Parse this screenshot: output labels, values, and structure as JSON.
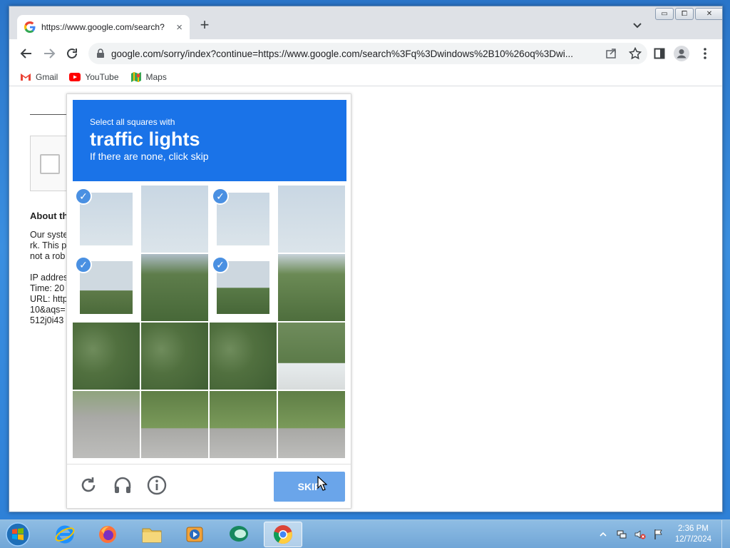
{
  "browser": {
    "tab_title": "https://www.google.com/search?",
    "tab_close": "×",
    "new_tab": "+",
    "url": "google.com/sorry/index?continue=https://www.google.com/search%3Fq%3Dwindows%2B10%26oq%3Dwi...",
    "window_controls": [
      "▭",
      "⧠",
      "✕"
    ]
  },
  "bookmarks": [
    {
      "label": "Gmail",
      "icon": "gmail-icon"
    },
    {
      "label": "YouTube",
      "icon": "youtube-icon"
    },
    {
      "label": "Maps",
      "icon": "maps-icon"
    }
  ],
  "page": {
    "about_heading": "About th",
    "about_text": "Our syste\nrk. This p\nnot a rob\n\nIP addres\nTime: 20\nURL: http\n10&aqs=\n512j0i43"
  },
  "captcha": {
    "instruction_small": "Select all squares with",
    "target": "traffic lights",
    "hint": "If there are none, click skip",
    "tiles_selected": [
      0,
      2,
      4,
      6
    ],
    "skip_label": "SKIP",
    "check_glyph": "✓"
  },
  "taskbar": {
    "apps": [
      "internet-explorer",
      "firefox",
      "file-explorer",
      "media-player",
      "app-bubble",
      "chrome"
    ],
    "active_app": "chrome",
    "time": "2:36 PM",
    "date": "12/7/2024"
  },
  "colors": {
    "captcha_header": "#1a73e8",
    "skip_button": "#6aa5ea",
    "check": "#4a90e2"
  }
}
